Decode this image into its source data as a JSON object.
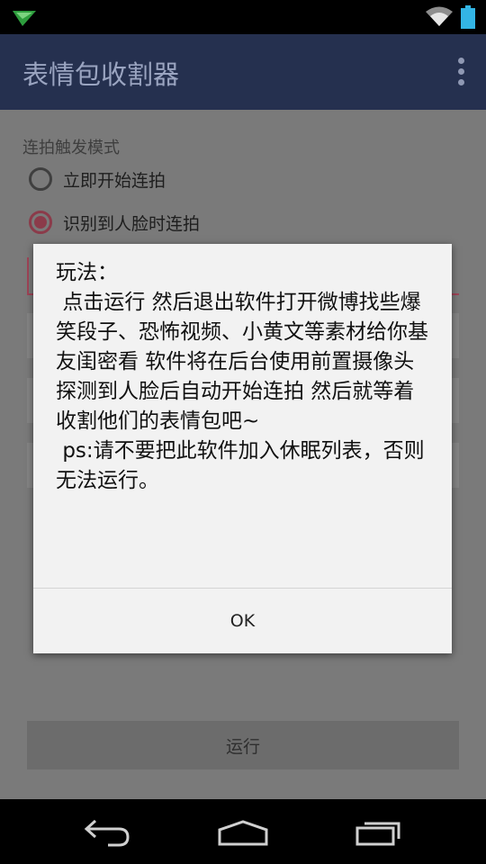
{
  "app": {
    "title": "表情包收割器"
  },
  "content": {
    "section_label": "连拍触发模式",
    "radio_options": [
      {
        "label": "立即开始连拍",
        "checked": false
      },
      {
        "label": "识别到人脸时连拍",
        "checked": true
      }
    ],
    "run_button": "运行"
  },
  "dialog": {
    "message": "玩法：\n 点击运行 然后退出软件打开微博找些爆笑段子、恐怖视频、小黄文等素材给你基友闺密看 软件将在后台使用前置摄像头 探测到人脸后自动开始连拍 然后就等着收割他们的表情包吧~\n ps:请不要把此软件加入休眠列表，否则无法运行。",
    "ok_label": "OK"
  },
  "colors": {
    "appbar": "#25304f",
    "accent": "#8b3b4a",
    "battery": "#33b5e5"
  },
  "icons": [
    "notification-arrow-icon",
    "wifi-icon",
    "battery-icon",
    "overflow-menu-icon",
    "back-icon",
    "home-icon",
    "recent-apps-icon"
  ]
}
